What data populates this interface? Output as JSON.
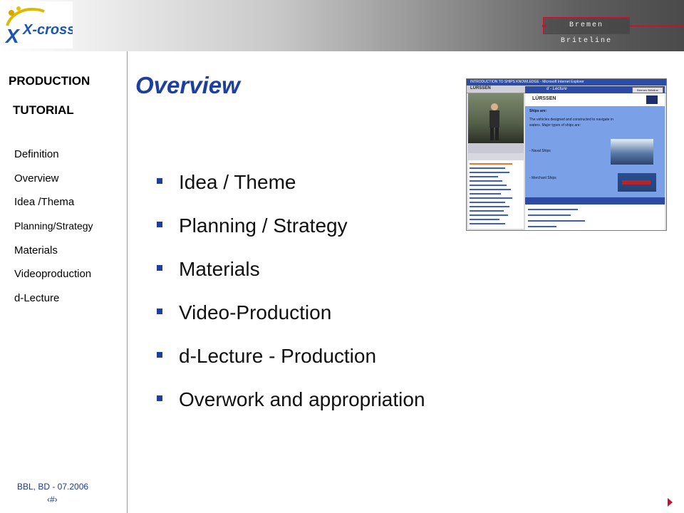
{
  "header": {
    "logo_text": "X-cross",
    "brand": "Bremen Briteline"
  },
  "sidebar": {
    "title_line1": "PRODUCTION",
    "title_line2": "TUTORIAL",
    "items": [
      {
        "label": "Definition"
      },
      {
        "label": "Overview"
      },
      {
        "label": "Idea /Thema"
      },
      {
        "label": "Planning/Strategy"
      },
      {
        "label": "Materials"
      },
      {
        "label": "Videoproduction"
      },
      {
        "label": "d-Lecture"
      }
    ]
  },
  "main": {
    "title": "Overview",
    "bullets": [
      {
        "text": "Idea / Theme"
      },
      {
        "text": "Planning / Strategy"
      },
      {
        "text": "Materials"
      },
      {
        "text": "Video-Production"
      },
      {
        "text": "d-Lecture - Production"
      },
      {
        "text": "Overwork and appropriation"
      }
    ]
  },
  "screenshot": {
    "window_title": "INTRODUCTION TO SHIPS KNOWLEDGE - Microsoft Internet Explorer",
    "left_logo": "LÜRSSEN",
    "lecture_title": "d - Lecture",
    "close_button": "Bremen Briteline",
    "slide_logo": "LÜRSSEN",
    "slide_heading": "Ships are:",
    "slide_line1": "The vehicles designed and constructed to navigate in",
    "slide_line2": "waters. Major types of ships are:",
    "slide_item1": "- Naval Ships",
    "slide_item2": "- Merchant Ships"
  },
  "footer": {
    "text": "BBL, BD - 07.2006",
    "page": "‹#›"
  },
  "colors": {
    "accent": "#1f3f9f",
    "brand_red": "#c8102e"
  }
}
